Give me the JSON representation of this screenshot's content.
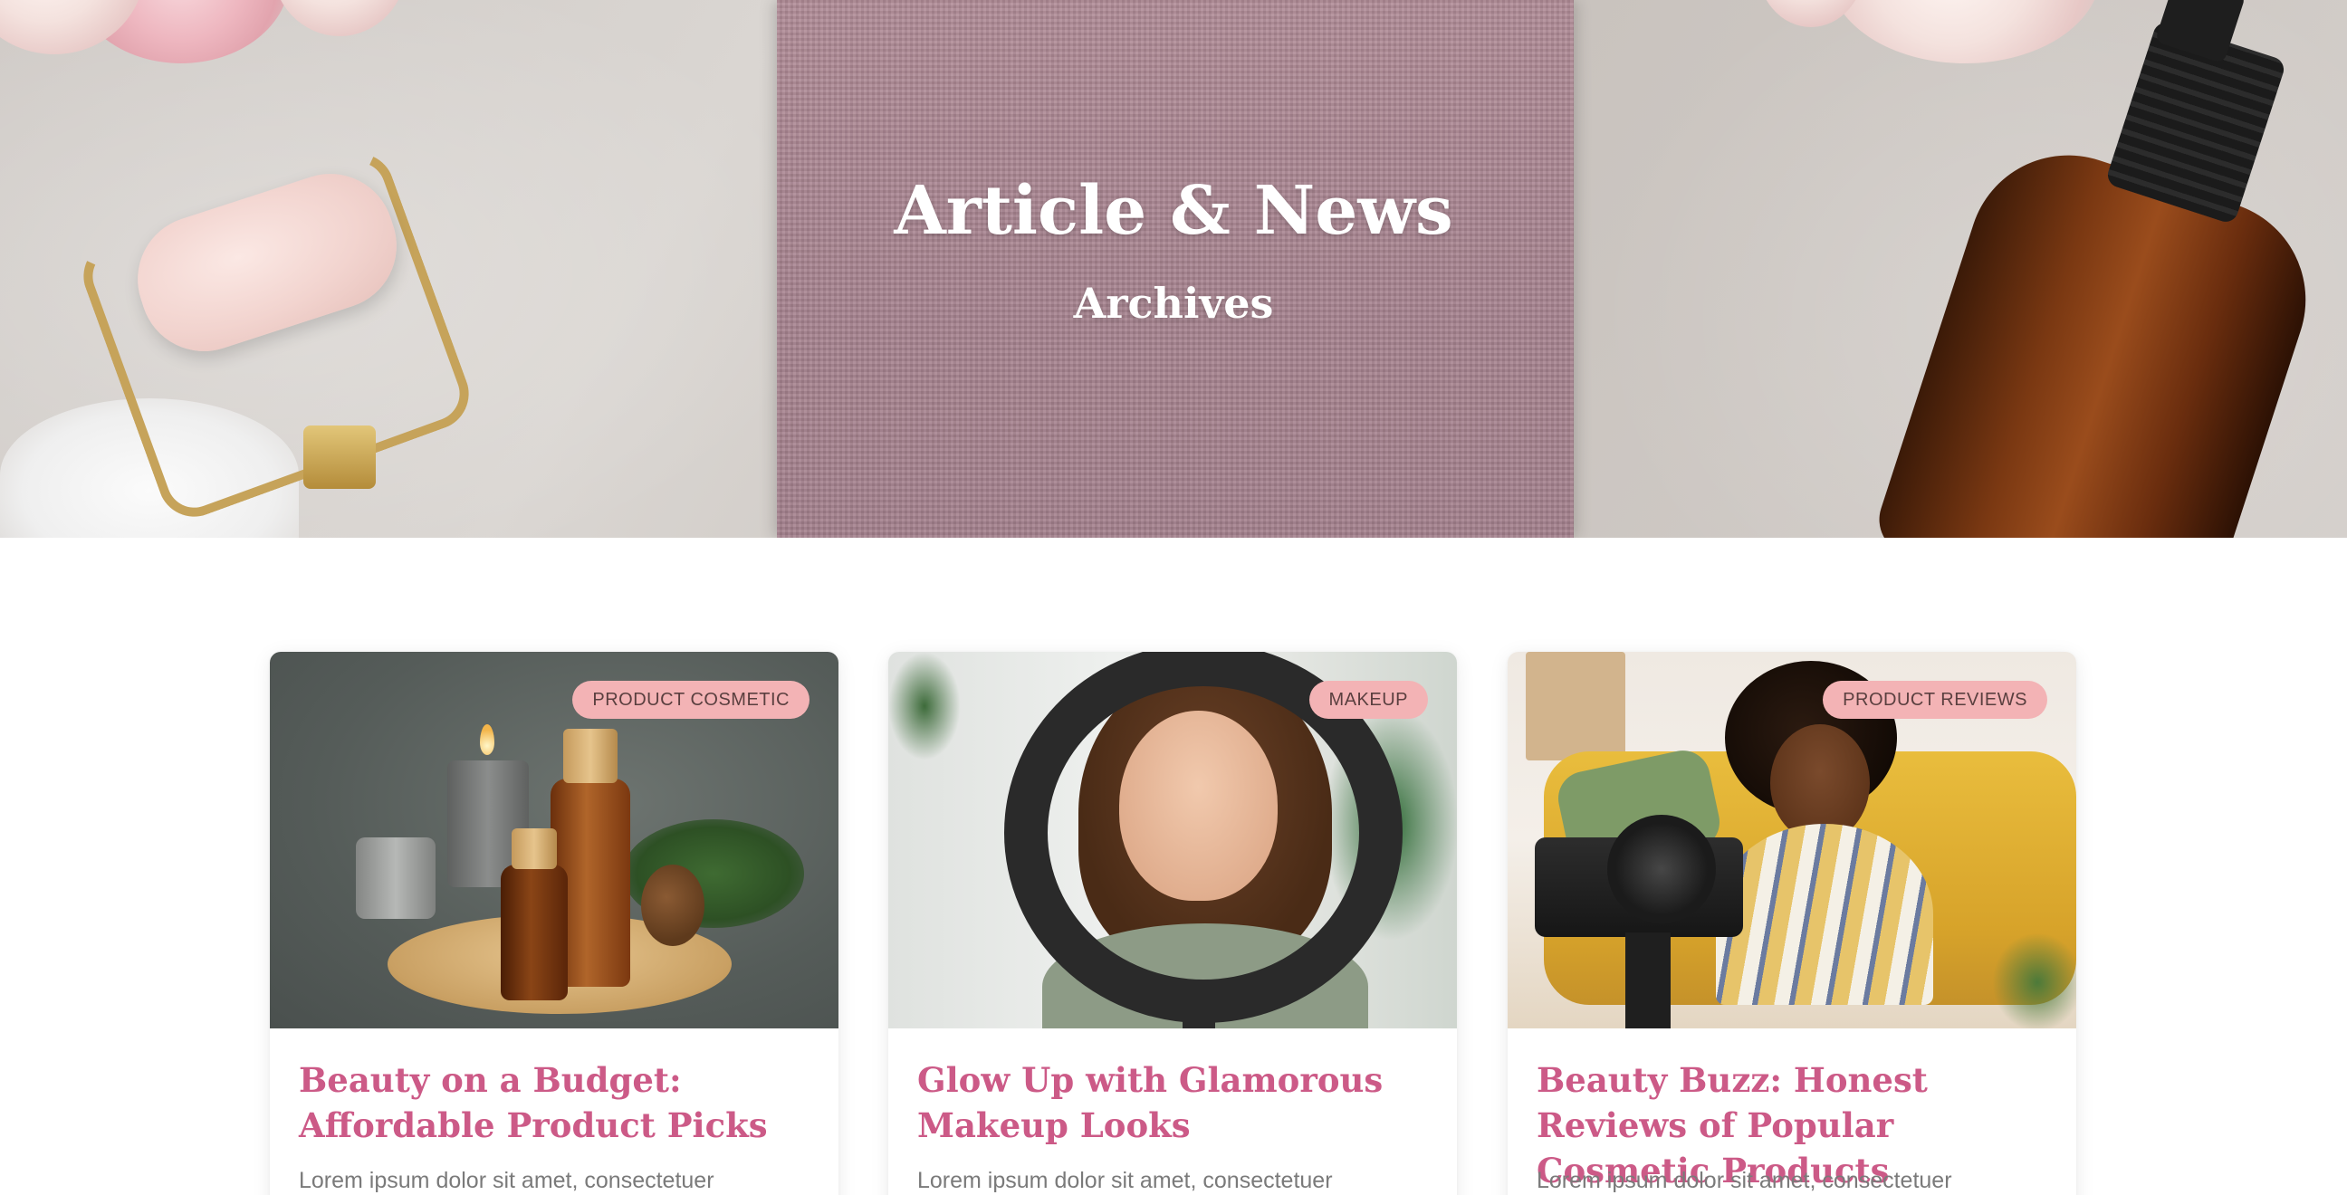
{
  "hero": {
    "title": "Article & News",
    "subtitle": "Archives"
  },
  "posts": [
    {
      "category": "PRODUCT COSMETIC",
      "title": "Beauty on a Budget: Affordable Product Picks",
      "excerpt": "Lorem ipsum dolor sit amet, consectetuer"
    },
    {
      "category": "MAKEUP",
      "title": "Glow Up with Glamorous Makeup Looks",
      "excerpt": "Lorem ipsum dolor sit amet, consectetuer"
    },
    {
      "category": "PRODUCT REVIEWS",
      "title": "Beauty Buzz: Honest Reviews of Popular Cosmetic Products",
      "excerpt": "Lorem ipsum dolor sit amet, consectetuer"
    }
  ],
  "colors": {
    "title_accent": "#cc5a87",
    "badge_bg": "#f3b3b5",
    "excerpt_text": "#7a7a7a"
  }
}
